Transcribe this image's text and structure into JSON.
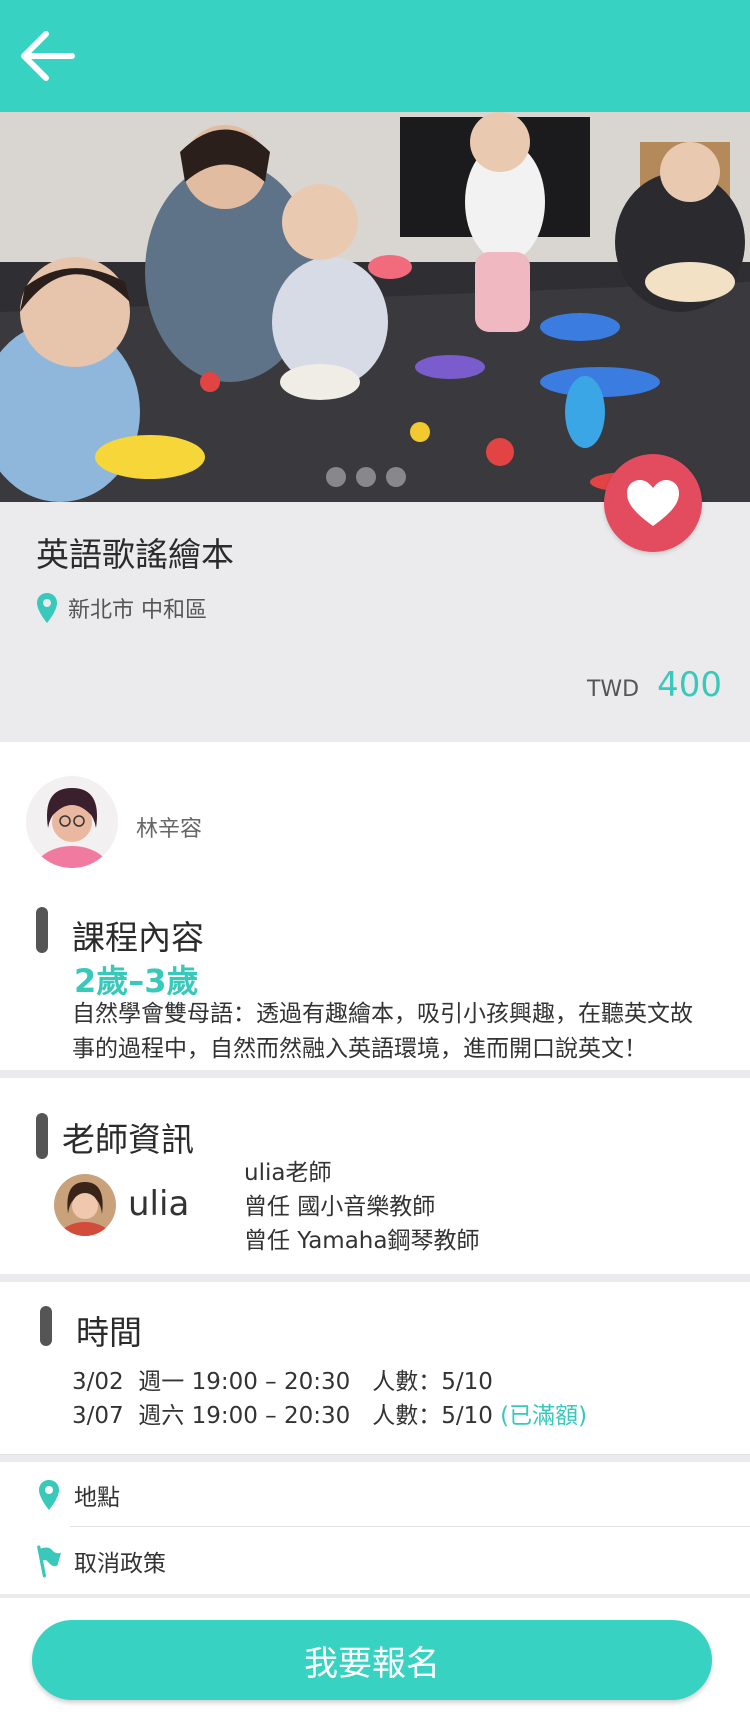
{
  "header": {
    "back_icon": "arrow-left-icon"
  },
  "hero": {
    "slide_count": 3,
    "active_slide": 1
  },
  "favorite": {
    "icon": "heart-icon",
    "active": true
  },
  "course": {
    "title": "英語歌謠繪本",
    "location": "新北市 中和區",
    "price_currency": "TWD",
    "price_value": "400"
  },
  "host": {
    "name": "林辛容"
  },
  "content_section": {
    "title": "課程內容",
    "age_range": "2歲–3歲",
    "description": "自然學會雙母語：透過有趣繪本，吸引小孩興趣，在聽英文故事的過程中，自然而然融入英語環境，進而開口說英文！"
  },
  "teacher_section": {
    "title": "老師資訊",
    "name": "ulia",
    "bio": [
      "ulia老師",
      "曾任 國小音樂教師",
      "曾任 Yamaha鋼琴教師"
    ]
  },
  "time_section": {
    "title": "時間",
    "sessions": [
      {
        "text": "3/02  週一 19:00 – 20:30   人數：5/10",
        "badge": ""
      },
      {
        "text": "3/07  週六 19:00 – 20:30   人數：5/10 ",
        "badge": "(已滿額)"
      }
    ]
  },
  "links": {
    "location_label": "地點",
    "cancel_policy_label": "取消政策"
  },
  "signup": {
    "label": "我要報名"
  },
  "colors": {
    "accent": "#38d2c3",
    "favorite": "#e34b5e",
    "price": "#38c9ba"
  }
}
